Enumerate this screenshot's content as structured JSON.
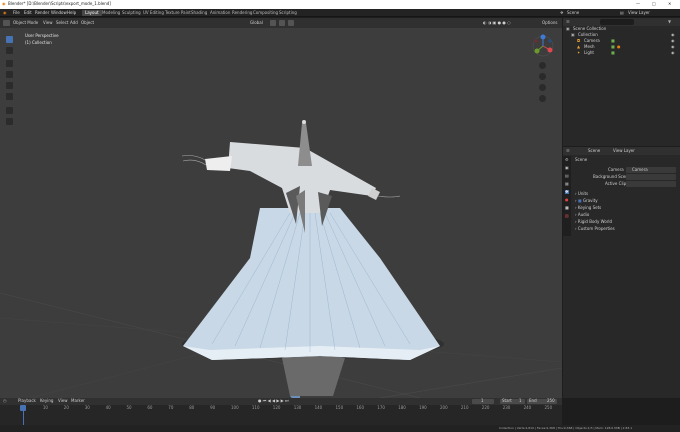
{
  "window": {
    "title": "Blender* [D:\\Blender\\Scripts\\export_mode_1.blend]",
    "controls": [
      "—",
      "□",
      "✕"
    ]
  },
  "menu": [
    "File",
    "Edit",
    "Render",
    "Window",
    "Help"
  ],
  "workspaces": [
    "Layout",
    "Modeling",
    "Sculpting",
    "UV Editing",
    "Texture Paint",
    "Shading",
    "Animation",
    "Rendering",
    "Compositing",
    "Scripting"
  ],
  "active_workspace": "Layout",
  "top_right": {
    "scene_label": "Scene",
    "view_layer_label": "View Layer"
  },
  "viewport_header": {
    "mode": "Object Mode",
    "menus": [
      "View",
      "Select",
      "Add",
      "Object"
    ],
    "transform": "Global",
    "options": "Options"
  },
  "overlay_text": {
    "view": "User Perspective",
    "collection": "(1) Collection"
  },
  "outliner": {
    "root": "Scene Collection",
    "items": [
      {
        "name": "Collection",
        "level": 1
      },
      {
        "name": "Camera",
        "level": 2
      },
      {
        "name": "Mesh",
        "level": 2
      },
      {
        "name": "Light",
        "level": 2
      }
    ]
  },
  "properties": {
    "tabs_label": [
      "Scene",
      "View Layer"
    ],
    "section": "Scene",
    "fields": [
      {
        "label": "Camera",
        "value": "Camera"
      },
      {
        "label": "Background Scene",
        "value": ""
      },
      {
        "label": "Active Clip",
        "value": ""
      }
    ],
    "subpanels": [
      {
        "label": "Units"
      },
      {
        "label": "Gravity",
        "checked": true
      },
      {
        "label": "Keying Sets"
      },
      {
        "label": "Audio"
      },
      {
        "label": "Rigid Body World"
      },
      {
        "label": "Custom Properties"
      }
    ]
  },
  "timeline": {
    "menus": [
      "Playback",
      "Keying",
      "View",
      "Marker"
    ],
    "current_frame": "1",
    "start_label": "Start",
    "start": "1",
    "end_label": "End",
    "end": "250",
    "ruler": [
      "0",
      "10",
      "20",
      "30",
      "40",
      "50",
      "60",
      "70",
      "80",
      "90",
      "100",
      "110",
      "120",
      "130",
      "140",
      "150",
      "160",
      "170",
      "180",
      "190",
      "200",
      "210",
      "220",
      "230",
      "240",
      "250"
    ]
  },
  "status": {
    "left": "",
    "right": "Collection | Verts:4,810 | Faces:9,368 | Tris:9,368 | Objects:1/3 | Mem: 128.0 MiB | 2.83.1"
  },
  "colors": {
    "accent": "#4772b3",
    "viewport": "#3d3d3d",
    "dress": "#c9d8e6"
  }
}
